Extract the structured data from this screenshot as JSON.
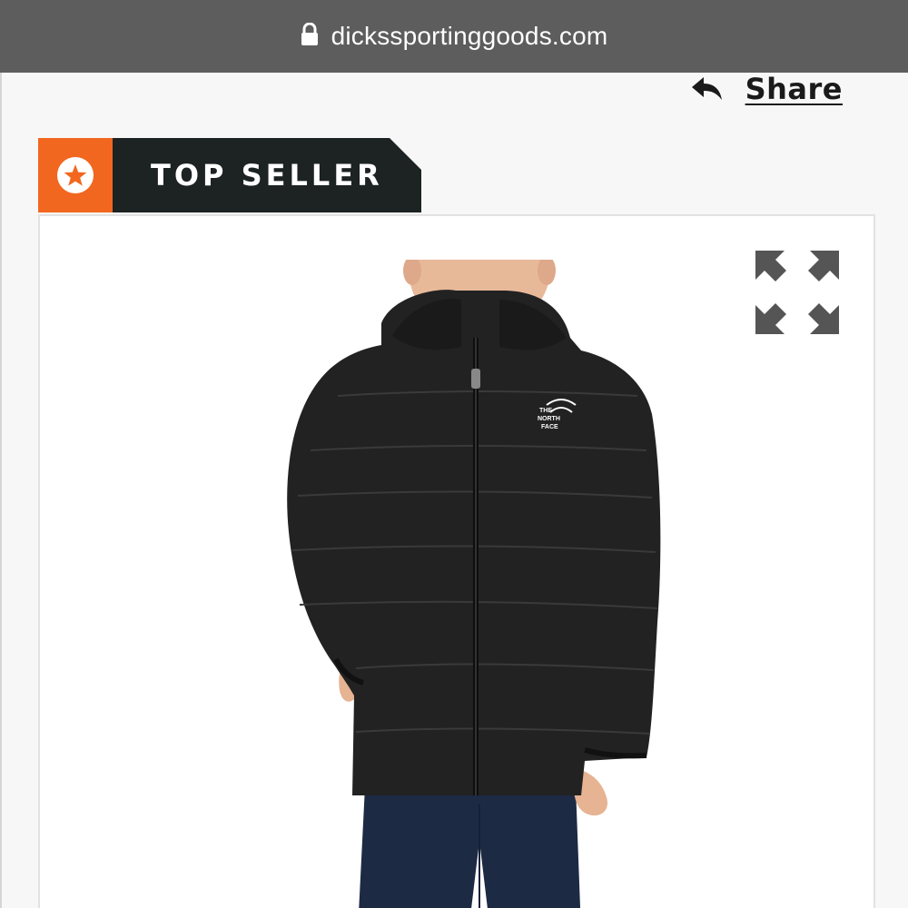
{
  "browser": {
    "url": "dickssportinggoods.com",
    "lock_icon": "lock-icon",
    "bar_color": "#5d5d5d"
  },
  "header": {
    "share_label": "Share",
    "share_icon": "share-arrow-icon"
  },
  "badge": {
    "label": "TOP SELLER",
    "icon": "star-circle-icon",
    "accent_color": "#f2671f",
    "background_color": "#1c2322"
  },
  "product": {
    "image_description_icon": "product-image",
    "logo_text": "THE NORTH FACE",
    "expand_icon": "expand-icon"
  }
}
